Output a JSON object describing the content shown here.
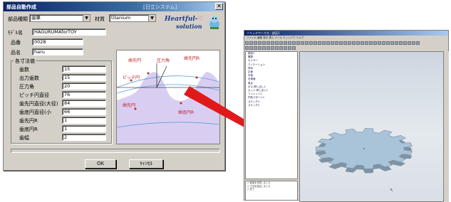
{
  "dialog": {
    "title": "部品自動作成",
    "system_title": "[日立システム]",
    "close_glyph": "✕",
    "part_type_label": "部品種類",
    "part_type_value": "歯車",
    "material_label": "材質",
    "material_value": "titanium",
    "model_name_label": "ﾓﾃﾞﾙ名",
    "model_name_value": "HAGURUMAforTOY",
    "part_no_label": "品番",
    "part_no_value": "0028",
    "part_name_label": "品名",
    "part_name_value": "haru",
    "logo_text_line1": "Heartful-",
    "logo_text_line2": "solution",
    "group_title": "各寸法値",
    "dimensions": [
      {
        "label": "歯数",
        "value": "15"
      },
      {
        "label": "出力歯数",
        "value": "15"
      },
      {
        "label": "圧力角",
        "value": "20"
      },
      {
        "label": "ピッチ円直径",
        "value": "76"
      },
      {
        "label": "歯先円直径(大径)",
        "value": "84"
      },
      {
        "label": "歯底円直径(小",
        "value": "66"
      },
      {
        "label": "歯先円R",
        "value": "1"
      },
      {
        "label": "歯底円R",
        "value": "1"
      },
      {
        "label": "歯幅",
        "value": "2"
      }
    ],
    "diagram_labels": {
      "tip_circle": "歯先円",
      "pressure_angle": "圧力角",
      "tip_circle_r": "歯先円R",
      "pitch_circle": "ピッチ円",
      "tip_circle_2": "歯先円",
      "root_circle_r": "歯底円R"
    },
    "ok_label": "OK",
    "cancel_label": "ｷｬﾝｾﾙ"
  },
  "cad": {
    "title": "ソリッドワークス - 部品1",
    "menu": "ファイル 編集 表示 挿入 ツール ウィンドウ ヘルプ",
    "tree_items": [
      "部品1",
      "履歴",
      "センサー",
      "アノテーション",
      "材料",
      "正面",
      "平面",
      "右側面",
      "原点",
      "ボス-押し出し1",
      "カット-押し出し1",
      "フィレット1",
      "円形パターン1",
      "スケッチ1",
      "スケッチ2"
    ],
    "messages": [
      "○ 部品を作成しました",
      "○ 寸法を設定しました",
      "○ 完了"
    ]
  },
  "colors": {
    "title_dark": "#0a246a",
    "dialog_bg": "#d4d0c8",
    "gear_fill": "#a9c3d8",
    "diagram_fill": "#d9cdf2",
    "arrow_red": "#e01a1a",
    "label_red": "#c0282a"
  }
}
